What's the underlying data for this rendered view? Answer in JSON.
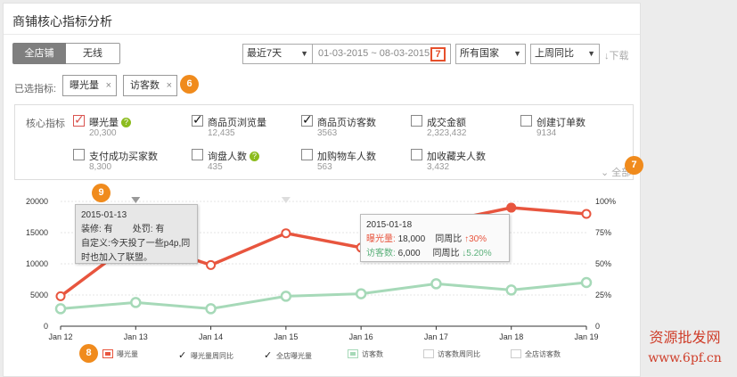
{
  "title": "商铺核心指标分析",
  "tabs": [
    "全店铺",
    "无线"
  ],
  "period": "最近7天",
  "date_range": "01-03-2015 ~ 08-03-2015",
  "calendar_num": "7",
  "country": "所有国家",
  "compare": "上周同比",
  "download": "↓下载",
  "selected_label": "已选指标:",
  "chips": [
    "曝光量",
    "访客数"
  ],
  "chip_x": "×",
  "badges": [
    "6",
    "7",
    "9",
    "8"
  ],
  "core_label": "核心指标",
  "metrics": [
    {
      "name": "曝光量",
      "value": "20,300",
      "checked": true,
      "q": true
    },
    {
      "name": "商品页浏览量",
      "value": "12,435",
      "checked": true
    },
    {
      "name": "商品页访客数",
      "value": "3563",
      "checked": true
    },
    {
      "name": "成交金额",
      "value": "2,323,432",
      "checked": false
    },
    {
      "name": "创建订单数",
      "value": "9134",
      "checked": false
    },
    {
      "name": "支付成功买家数",
      "value": "8,300",
      "checked": false
    },
    {
      "name": "询盘人数",
      "value": "435",
      "checked": false,
      "q": true
    },
    {
      "name": "加购物车人数",
      "value": "563",
      "checked": false
    },
    {
      "name": "加收藏夹人数",
      "value": "3,432",
      "checked": false
    }
  ],
  "q_mark": "?",
  "all": "全部",
  "tooltip1": {
    "date": "2015-01-13",
    "line1a": "装修:",
    "line1b": "有",
    "line1c": "处罚:",
    "line1d": "有",
    "line2": "自定义:今天投了一些p4p,同",
    "line3": "时也加入了联盟。"
  },
  "tooltip2": {
    "date": "2015-01-18",
    "r1label": "曝光量:",
    "r1val": "18,000",
    "r1cmp": "同周比",
    "r1chg": "↑30%",
    "r2label": "访客数:",
    "r2val": "6,000",
    "r2cmp": "同周比",
    "r2chg": "↓5.20%"
  },
  "legend": [
    "曝光量",
    "曝光量周同比",
    "全店曝光量",
    "访客数",
    "访客数周同比",
    "全店访客数"
  ],
  "watermark1": "资源批发网",
  "watermark2": "www.6pf.cn",
  "chart_data": {
    "type": "line",
    "categories": [
      "Jan 12",
      "Jan 13",
      "Jan 14",
      "Jan 15",
      "Jan 16",
      "Jan 17",
      "Jan 18",
      "Jan 19"
    ],
    "series": [
      {
        "name": "曝光量",
        "axis": "left",
        "values": [
          4800,
          13800,
          9800,
          14900,
          12600,
          16500,
          19000,
          18000
        ],
        "color": "#e8553e"
      },
      {
        "name": "访客数",
        "axis": "right",
        "values": [
          14,
          19,
          14,
          24,
          26,
          34,
          29,
          35
        ],
        "color": "#a6d9b8"
      }
    ],
    "ylim_left": [
      0,
      20000
    ],
    "yticks_left": [
      "0",
      "5000",
      "10000",
      "15000",
      "20000"
    ],
    "ylim_right": [
      0,
      100
    ],
    "yticks_right": [
      "0",
      "25%",
      "50%",
      "75%",
      "100%"
    ],
    "grid": true
  }
}
